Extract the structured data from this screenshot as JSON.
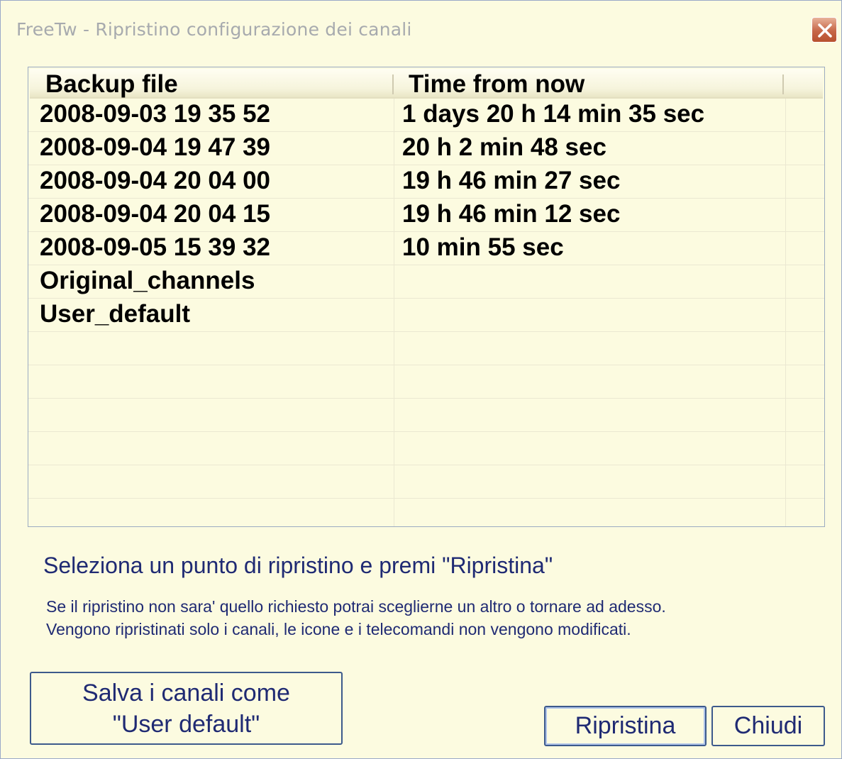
{
  "window": {
    "title": "FreeTw - Ripristino configurazione dei canali",
    "close_icon": "close-icon"
  },
  "table": {
    "columns": [
      "Backup file",
      "Time from now"
    ],
    "rows": [
      {
        "file": "2008-09-03  19 35 52",
        "time": "1 days  20 h  14 min  35 sec"
      },
      {
        "file": "2008-09-04  19 47 39",
        "time": "20 h  2 min  48 sec"
      },
      {
        "file": "2008-09-04  20 04 00",
        "time": "19 h  46 min  27 sec"
      },
      {
        "file": "2008-09-04  20 04 15",
        "time": "19 h  46 min  12 sec"
      },
      {
        "file": "2008-09-05  15 39 32",
        "time": "10 min  55 sec"
      },
      {
        "file": "Original_channels",
        "time": ""
      },
      {
        "file": "User_default",
        "time": ""
      },
      {
        "file": "",
        "time": ""
      },
      {
        "file": "",
        "time": ""
      },
      {
        "file": "",
        "time": ""
      },
      {
        "file": "",
        "time": ""
      },
      {
        "file": "",
        "time": ""
      },
      {
        "file": "",
        "time": ""
      }
    ]
  },
  "messages": {
    "main": "Seleziona un punto di ripristino e premi \"Ripristina\"",
    "line1": "Se il ripristino non sara' quello richiesto potrai sceglierne un altro o tornare ad adesso.",
    "line2": "Vengono ripristinati solo i canali, le icone e i telecomandi non vengono modificati."
  },
  "buttons": {
    "save_line1": "Salva i canali come",
    "save_line2": "\"User default\"",
    "restore": "Ripristina",
    "close": "Chiudi"
  },
  "colors": {
    "background": "#fcfbe0",
    "text_blue": "#1f2a73",
    "close_button": "#c76748"
  }
}
